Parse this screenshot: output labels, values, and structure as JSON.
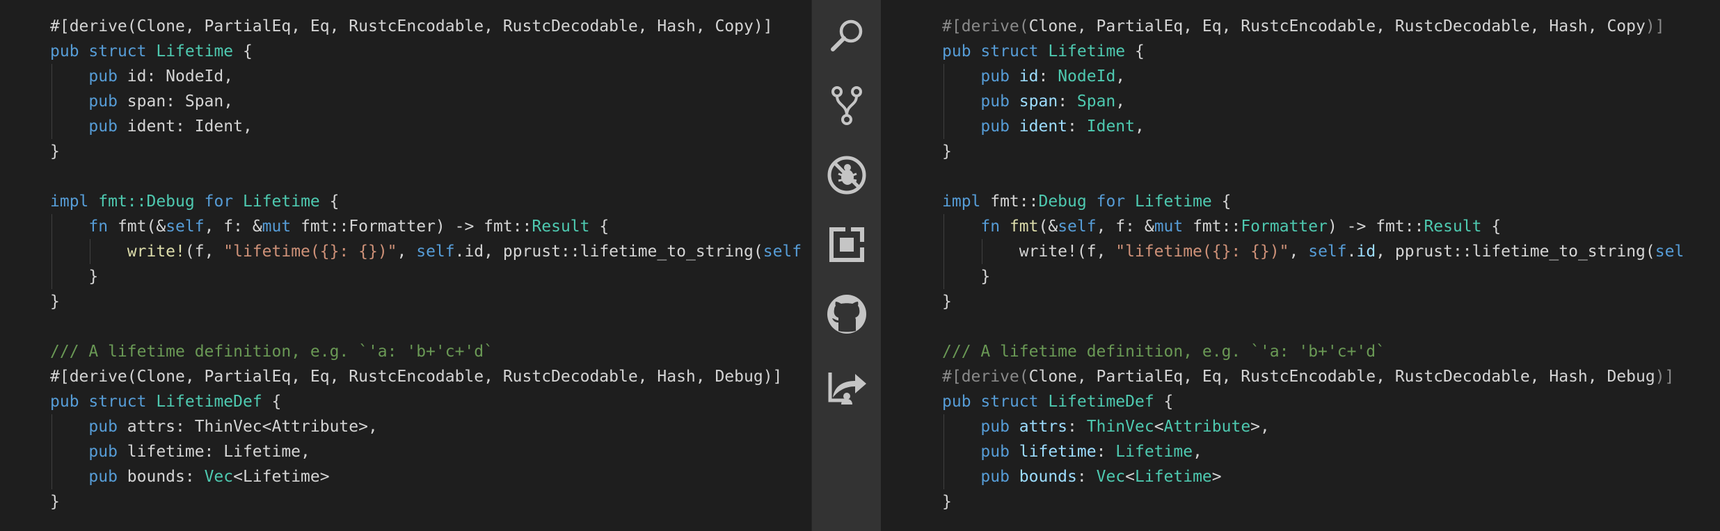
{
  "left_editor": {
    "lines": [
      [
        {
          "t": "#[derive(Clone, PartialEq, Eq, RustcEncodable, RustcDecodable, Hash, Copy)]",
          "c": "attr"
        }
      ],
      [
        {
          "t": "pub",
          "c": "kw"
        },
        {
          "t": " ",
          "c": "plain"
        },
        {
          "t": "struct",
          "c": "kw"
        },
        {
          "t": " ",
          "c": "plain"
        },
        {
          "t": "Lifetime",
          "c": "type"
        },
        {
          "t": " {",
          "c": "punct"
        }
      ],
      [
        {
          "t": "    ",
          "c": "plain"
        },
        {
          "t": "pub",
          "c": "kw"
        },
        {
          "t": " id: NodeId,",
          "c": "plain"
        }
      ],
      [
        {
          "t": "    ",
          "c": "plain"
        },
        {
          "t": "pub",
          "c": "kw"
        },
        {
          "t": " span: Span,",
          "c": "plain"
        }
      ],
      [
        {
          "t": "    ",
          "c": "plain"
        },
        {
          "t": "pub",
          "c": "kw"
        },
        {
          "t": " ident: Ident,",
          "c": "plain"
        }
      ],
      [
        {
          "t": "}",
          "c": "punct"
        }
      ],
      [],
      [
        {
          "t": "impl",
          "c": "kw"
        },
        {
          "t": " ",
          "c": "plain"
        },
        {
          "t": "fmt::Debug",
          "c": "path"
        },
        {
          "t": " ",
          "c": "plain"
        },
        {
          "t": "for",
          "c": "kw"
        },
        {
          "t": " ",
          "c": "plain"
        },
        {
          "t": "Lifetime",
          "c": "type"
        },
        {
          "t": " {",
          "c": "punct"
        }
      ],
      [
        {
          "t": "    ",
          "c": "plain"
        },
        {
          "t": "fn",
          "c": "kw"
        },
        {
          "t": " fmt(&",
          "c": "plain"
        },
        {
          "t": "self",
          "c": "self"
        },
        {
          "t": ", f: &",
          "c": "plain"
        },
        {
          "t": "mut",
          "c": "kw"
        },
        {
          "t": " fmt::Formatter) -> fmt::",
          "c": "plain"
        },
        {
          "t": "Result",
          "c": "type"
        },
        {
          "t": " {",
          "c": "punct"
        }
      ],
      [
        {
          "t": "        ",
          "c": "plain"
        },
        {
          "t": "write!",
          "c": "macro"
        },
        {
          "t": "(f, ",
          "c": "plain"
        },
        {
          "t": "\"lifetime({}: {})\"",
          "c": "string"
        },
        {
          "t": ", ",
          "c": "plain"
        },
        {
          "t": "self",
          "c": "self"
        },
        {
          "t": ".id, pprust::lifetime_to_string(",
          "c": "plain"
        },
        {
          "t": "self",
          "c": "self"
        }
      ],
      [
        {
          "t": "    }",
          "c": "punct"
        }
      ],
      [
        {
          "t": "}",
          "c": "punct"
        }
      ],
      [],
      [
        {
          "t": "/// A lifetime definition, e.g. `'a: 'b+'c+'d`",
          "c": "comment"
        }
      ],
      [
        {
          "t": "#[derive(Clone, PartialEq, Eq, RustcEncodable, RustcDecodable, Hash, Debug)]",
          "c": "attr"
        }
      ],
      [
        {
          "t": "pub",
          "c": "kw"
        },
        {
          "t": " ",
          "c": "plain"
        },
        {
          "t": "struct",
          "c": "kw"
        },
        {
          "t": " ",
          "c": "plain"
        },
        {
          "t": "LifetimeDef",
          "c": "type"
        },
        {
          "t": " {",
          "c": "punct"
        }
      ],
      [
        {
          "t": "    ",
          "c": "plain"
        },
        {
          "t": "pub",
          "c": "kw"
        },
        {
          "t": " attrs: ThinVec<Attribute>,",
          "c": "plain"
        }
      ],
      [
        {
          "t": "    ",
          "c": "plain"
        },
        {
          "t": "pub",
          "c": "kw"
        },
        {
          "t": " lifetime: Lifetime,",
          "c": "plain"
        }
      ],
      [
        {
          "t": "    ",
          "c": "plain"
        },
        {
          "t": "pub",
          "c": "kw"
        },
        {
          "t": " bounds: ",
          "c": "plain"
        },
        {
          "t": "Vec",
          "c": "type"
        },
        {
          "t": "<Lifetime>",
          "c": "plain"
        }
      ],
      [
        {
          "t": "}",
          "c": "punct"
        }
      ]
    ]
  },
  "right_editor": {
    "lines": [
      [
        {
          "t": "#[derive(",
          "c": "attr"
        },
        {
          "t": "Clone, PartialEq, Eq, RustcEncodable, RustcDecodable, Hash, Copy",
          "c": "plain"
        },
        {
          "t": ")]",
          "c": "attr"
        }
      ],
      [
        {
          "t": "pub",
          "c": "kw"
        },
        {
          "t": " ",
          "c": "plain"
        },
        {
          "t": "struct",
          "c": "kw"
        },
        {
          "t": " ",
          "c": "plain"
        },
        {
          "t": "Lifetime",
          "c": "type"
        },
        {
          "t": " {",
          "c": "punct"
        }
      ],
      [
        {
          "t": "    ",
          "c": "plain"
        },
        {
          "t": "pub",
          "c": "kw"
        },
        {
          "t": " ",
          "c": "plain"
        },
        {
          "t": "id",
          "c": "field"
        },
        {
          "t": ": ",
          "c": "plain"
        },
        {
          "t": "NodeId",
          "c": "type"
        },
        {
          "t": ",",
          "c": "punct"
        }
      ],
      [
        {
          "t": "    ",
          "c": "plain"
        },
        {
          "t": "pub",
          "c": "kw"
        },
        {
          "t": " ",
          "c": "plain"
        },
        {
          "t": "span",
          "c": "field"
        },
        {
          "t": ": ",
          "c": "plain"
        },
        {
          "t": "Span",
          "c": "type"
        },
        {
          "t": ",",
          "c": "punct"
        }
      ],
      [
        {
          "t": "    ",
          "c": "plain"
        },
        {
          "t": "pub",
          "c": "kw"
        },
        {
          "t": " ",
          "c": "plain"
        },
        {
          "t": "ident",
          "c": "field"
        },
        {
          "t": ": ",
          "c": "plain"
        },
        {
          "t": "Ident",
          "c": "type"
        },
        {
          "t": ",",
          "c": "punct"
        }
      ],
      [
        {
          "t": "}",
          "c": "punct"
        }
      ],
      [],
      [
        {
          "t": "impl",
          "c": "kw"
        },
        {
          "t": " fmt::",
          "c": "plain"
        },
        {
          "t": "Debug",
          "c": "type"
        },
        {
          "t": " ",
          "c": "plain"
        },
        {
          "t": "for",
          "c": "kw"
        },
        {
          "t": " ",
          "c": "plain"
        },
        {
          "t": "Lifetime",
          "c": "type"
        },
        {
          "t": " {",
          "c": "punct"
        }
      ],
      [
        {
          "t": "    ",
          "c": "plain"
        },
        {
          "t": "fn",
          "c": "kw"
        },
        {
          "t": " ",
          "c": "plain"
        },
        {
          "t": "fmt",
          "c": "fn"
        },
        {
          "t": "(&",
          "c": "plain"
        },
        {
          "t": "self",
          "c": "self"
        },
        {
          "t": ", f: &",
          "c": "plain"
        },
        {
          "t": "mut",
          "c": "kw"
        },
        {
          "t": " fmt::",
          "c": "plain"
        },
        {
          "t": "Formatter",
          "c": "type"
        },
        {
          "t": ") -> fmt::",
          "c": "plain"
        },
        {
          "t": "Result",
          "c": "type"
        },
        {
          "t": " {",
          "c": "punct"
        }
      ],
      [
        {
          "t": "        ",
          "c": "plain"
        },
        {
          "t": "write!",
          "c": "macro"
        },
        {
          "t": "(f, ",
          "c": "plain"
        },
        {
          "t": "\"lifetime({}: {})\"",
          "c": "string"
        },
        {
          "t": ", ",
          "c": "plain"
        },
        {
          "t": "self",
          "c": "self"
        },
        {
          "t": ".",
          "c": "plain"
        },
        {
          "t": "id",
          "c": "field"
        },
        {
          "t": ", pprust::lifetime_to_string(",
          "c": "plain"
        },
        {
          "t": "sel",
          "c": "self"
        }
      ],
      [
        {
          "t": "    }",
          "c": "punct"
        }
      ],
      [
        {
          "t": "}",
          "c": "punct"
        }
      ],
      [],
      [
        {
          "t": "/// A lifetime definition, e.g. `'a: 'b+'c+'d`",
          "c": "comment"
        }
      ],
      [
        {
          "t": "#[derive(",
          "c": "attr"
        },
        {
          "t": "Clone, PartialEq, Eq, RustcEncodable, RustcDecodable, Hash, Debug",
          "c": "plain"
        },
        {
          "t": ")]",
          "c": "attr"
        }
      ],
      [
        {
          "t": "pub",
          "c": "kw"
        },
        {
          "t": " ",
          "c": "plain"
        },
        {
          "t": "struct",
          "c": "kw"
        },
        {
          "t": " ",
          "c": "plain"
        },
        {
          "t": "LifetimeDef",
          "c": "type"
        },
        {
          "t": " {",
          "c": "punct"
        }
      ],
      [
        {
          "t": "    ",
          "c": "plain"
        },
        {
          "t": "pub",
          "c": "kw"
        },
        {
          "t": " ",
          "c": "plain"
        },
        {
          "t": "attrs",
          "c": "field"
        },
        {
          "t": ": ",
          "c": "plain"
        },
        {
          "t": "ThinVec",
          "c": "type"
        },
        {
          "t": "<",
          "c": "plain"
        },
        {
          "t": "Attribute",
          "c": "type"
        },
        {
          "t": ">,",
          "c": "plain"
        }
      ],
      [
        {
          "t": "    ",
          "c": "plain"
        },
        {
          "t": "pub",
          "c": "kw"
        },
        {
          "t": " ",
          "c": "plain"
        },
        {
          "t": "lifetime",
          "c": "field"
        },
        {
          "t": ": ",
          "c": "plain"
        },
        {
          "t": "Lifetime",
          "c": "type"
        },
        {
          "t": ",",
          "c": "punct"
        }
      ],
      [
        {
          "t": "    ",
          "c": "plain"
        },
        {
          "t": "pub",
          "c": "kw"
        },
        {
          "t": " ",
          "c": "plain"
        },
        {
          "t": "bounds",
          "c": "field"
        },
        {
          "t": ": ",
          "c": "plain"
        },
        {
          "t": "Vec",
          "c": "type"
        },
        {
          "t": "<",
          "c": "plain"
        },
        {
          "t": "Lifetime",
          "c": "type"
        },
        {
          "t": ">",
          "c": "plain"
        }
      ],
      [
        {
          "t": "}",
          "c": "punct"
        }
      ]
    ]
  },
  "activity_bar": {
    "items": [
      {
        "name": "search-icon"
      },
      {
        "name": "source-control-icon"
      },
      {
        "name": "debug-icon"
      },
      {
        "name": "extensions-icon"
      },
      {
        "name": "github-icon"
      },
      {
        "name": "live-share-icon"
      }
    ]
  },
  "colors": {
    "editor_background": "#1e1e1e",
    "activity_bar_background": "#333333",
    "keyword": "#569cd6",
    "type": "#4ec9b0",
    "string": "#ce9178",
    "comment": "#6a9955",
    "field": "#9cdcfe",
    "function": "#dcdcaa",
    "attribute_dim": "#8a8a8a",
    "icon": "#c5c5c5"
  }
}
